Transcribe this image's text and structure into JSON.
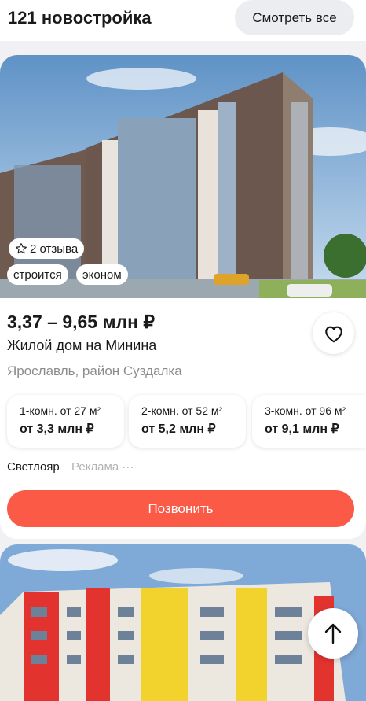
{
  "header": {
    "title": "121 новостройка",
    "see_all": "Смотреть все"
  },
  "listing": {
    "reviews": "2 отзыва",
    "status": "строится",
    "class": "эконом",
    "price": "3,37 – 9,65 млн ₽",
    "name": "Жилой дом на Минина",
    "location": "Ярославль, район Суздалка",
    "apartments": [
      {
        "area": "1-комн. от 27 м²",
        "price": "от 3,3 млн ₽"
      },
      {
        "area": "2-комн. от 52 м²",
        "price": "от 5,2 млн ₽"
      },
      {
        "area": "3-комн. от 96 м²",
        "price": "от 9,1 млн ₽"
      }
    ],
    "developer": "Светлояр",
    "ad_label": "Реклама ···",
    "call_label": "Позвонить"
  },
  "colors": {
    "accent": "#fb5a47",
    "muted": "#8c8c8c"
  }
}
